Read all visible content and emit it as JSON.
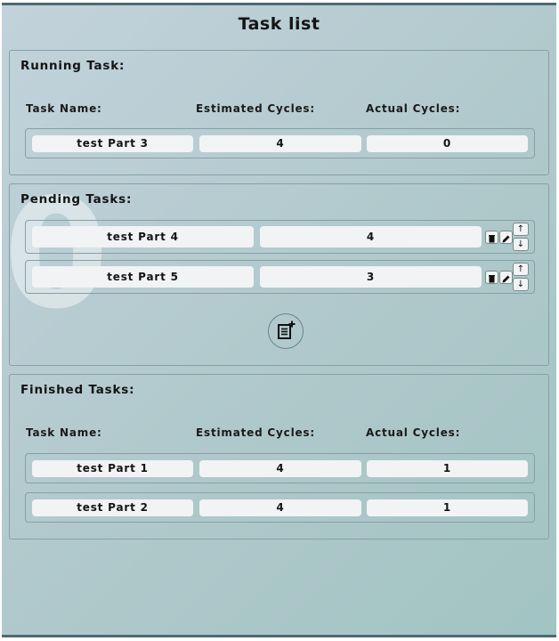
{
  "title": "Task list",
  "watermark": "0",
  "running": {
    "title": "Running Task:",
    "headers": {
      "name": "Task Name:",
      "estimated": "Estimated Cycles:",
      "actual": "Actual Cycles:"
    },
    "task": {
      "name": "test Part 3",
      "estimated": "4",
      "actual": "0"
    }
  },
  "pending": {
    "title": "Pending Tasks:",
    "tasks": [
      {
        "name": "test Part 4",
        "estimated": "4"
      },
      {
        "name": "test Part 5",
        "estimated": "3"
      }
    ],
    "move_up_label": "↑",
    "move_down_label": "↓",
    "add_icon": "add-task-icon"
  },
  "finished": {
    "title": "Finished Tasks:",
    "headers": {
      "name": "Task Name:",
      "estimated": "Estimated Cycles:",
      "actual": "Actual Cycles:"
    },
    "tasks": [
      {
        "name": "test Part 1",
        "estimated": "4",
        "actual": "1"
      },
      {
        "name": "test Part 2",
        "estimated": "4",
        "actual": "1"
      }
    ]
  }
}
